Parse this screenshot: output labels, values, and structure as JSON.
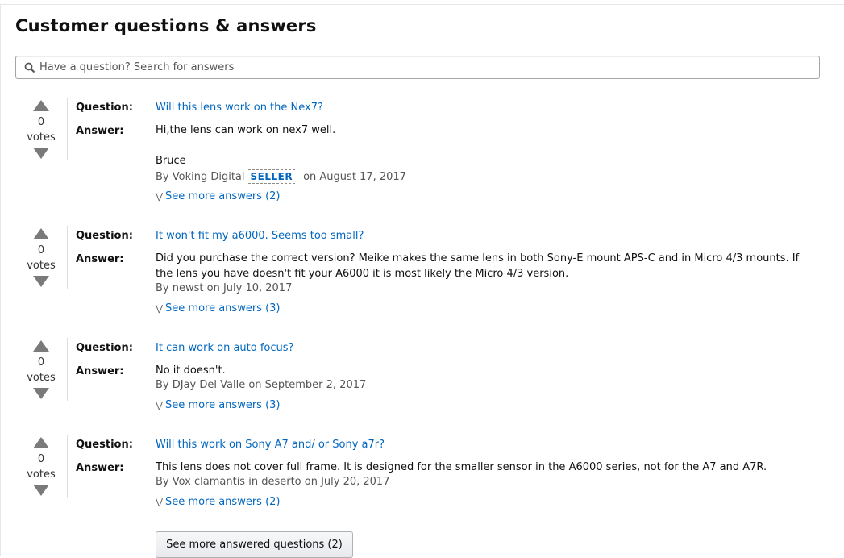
{
  "title": "Customer questions & answers",
  "search": {
    "placeholder": "Have a question? Search for answers"
  },
  "labels": {
    "question": "Question:",
    "answer": "Answer:",
    "votes": "votes",
    "seller": "SELLER"
  },
  "items": [
    {
      "votes": "0",
      "question": "Will this lens work on the Nex7?",
      "answer_lines": [
        "Hi,the lens can work on nex7 well.",
        "",
        "Bruce"
      ],
      "by_prefix": "By Voking Digital",
      "seller": true,
      "date": "on August 17, 2017",
      "byline": "",
      "more": "See more answers (2)"
    },
    {
      "votes": "0",
      "question": "It won't fit my a6000. Seems too small?",
      "answer": "Did you purchase the correct version? Meike makes the same lens in both Sony-E mount APS-C and in Micro 4/3 mounts. If the lens you have doesn't fit your A6000 it is most likely the Micro 4/3 version.",
      "byline": "By newst on July 10, 2017",
      "more": "See more answers (3)"
    },
    {
      "votes": "0",
      "question": "It can work on auto focus?",
      "answer": "No it doesn't.",
      "byline": "By DJay Del Valle on September 2, 2017",
      "more": "See more answers (3)"
    },
    {
      "votes": "0",
      "question": "Will this work on Sony A7 and/ or Sony a7r?",
      "answer": "This lens does not cover full frame. It is designed for the smaller sensor in the A6000 series, not for the A7 and A7R.",
      "byline": "By Vox clamantis in deserto on July 20, 2017",
      "more": "See more answers (2)"
    }
  ],
  "more_questions": "See more answered questions (2)",
  "colors": {
    "link": "#0066c0",
    "arrow": "#7a7a7a"
  }
}
